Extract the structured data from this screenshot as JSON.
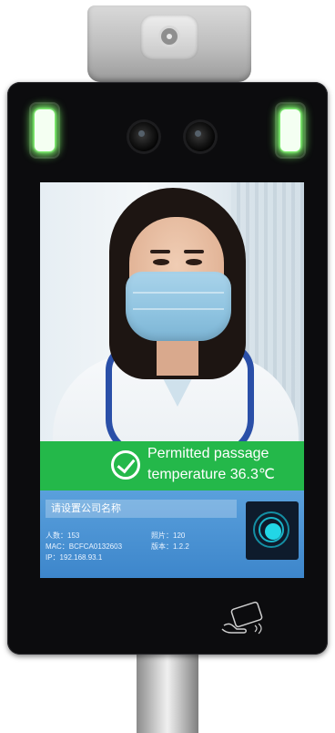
{
  "screen": {
    "banner": {
      "line1": "Permitted passage",
      "line2": "temperature 36.3℃",
      "icon": "check-circle-icon",
      "color": "#24b84a"
    },
    "info": {
      "company_name": "请设置公司名称",
      "people": "人数：153",
      "photos": "照片：120",
      "mac": "MAC：BCFCA0132603",
      "version": "版本：1.2.2",
      "ip": "IP：192.168.93.1",
      "color": "#3d86cb"
    },
    "nfc_icon": "nfc-scan-icon"
  },
  "device": {
    "card_reader_icon": "card-tap-icon",
    "indicator_color": "#7cff6a"
  }
}
